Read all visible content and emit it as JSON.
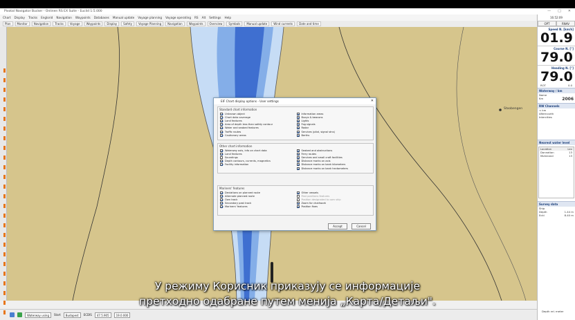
{
  "window": {
    "title": "Pivotal Navigator Bucker - Onlinen RS EX Suite - Euclid 1:5.000",
    "controls": [
      "—",
      "□",
      "✕"
    ]
  },
  "menu": [
    "Chart",
    "Display",
    "Tracks",
    "Englorid",
    "Navigation",
    "Waypoints",
    "Databases",
    "Manual update",
    "Voyage planning",
    "Voyage operating",
    "RS",
    "Alt",
    "Settings",
    "Help"
  ],
  "toolbar1": [
    "Plan",
    "Monitor",
    "Navigation",
    "Tracks",
    "Voyage",
    "Waypoints",
    "Display",
    "Safety",
    "Voyage Planning",
    "Navigation",
    "Waypoints",
    "Overview",
    "Symbols",
    "Manual update",
    "Wind currents",
    "Date and time"
  ],
  "toolbar2": {
    "look_ahead": "Look ahead",
    "center_ship": "Center ship",
    "scale": "Scale",
    "range": "Range"
  },
  "right_panel": {
    "time": "16:52:09",
    "tabs": [
      "OPT",
      "RNAV"
    ],
    "speed_label": "Speed N. [km/h]",
    "speed_value": "01.9",
    "course_label": "Course N. [°]",
    "course_value": "79.0",
    "heading_label": "Heading N. [°]",
    "heading_value": "79.0",
    "heading_extra_left": "ROT",
    "heading_extra_right": "0.0",
    "waterway_head": "Waterway / km",
    "waterway_rows": [
      [
        "Name",
        ""
      ],
      [
        "Km",
        "2006"
      ]
    ],
    "rw_head": "RW Channels",
    "rw_rows": [
      "< km",
      "Afterncorth",
      "Intercities"
    ],
    "nearest_head": "Nearest water level",
    "nearest_cols": [
      "Location",
      "Lev"
    ],
    "nearest_rows": [
      [
        "Donnation",
        "13"
      ],
      [
        "Mohnland",
        "13"
      ]
    ],
    "survey_head": "Survey data",
    "survey_rows": [
      [
        "Ship",
        ""
      ],
      [
        "Depth",
        "1.44 m"
      ],
      [
        "Ecki",
        "8.40 m"
      ]
    ],
    "bottom_label": "Depth rel. meter"
  },
  "map": {
    "place_label": "Stoobengen",
    "coast_color": "#d6c58c",
    "water_deep": "#3f6fd0",
    "water_mid": "#84aee8",
    "water_shallow": "#c6dcf5"
  },
  "dialog": {
    "title": "EIF Chart display options - User settings",
    "group1_title": "Standard chart information",
    "group1_left": [
      {
        "label": "Unknown object",
        "on": true
      },
      {
        "label": "Chart data coverage",
        "on": true
      },
      {
        "label": "Land features",
        "on": true
      },
      {
        "label": "Area of depth less than safety contour",
        "on": true
      },
      {
        "label": "Water and seabed features",
        "on": true
      },
      {
        "label": "Traffic routes",
        "on": true
      },
      {
        "label": "Cautionary areas",
        "on": true
      }
    ],
    "group1_right": [
      {
        "label": "Information areas",
        "on": true
      },
      {
        "label": "Buoys & beacons",
        "on": true
      },
      {
        "label": "Lights",
        "on": true
      },
      {
        "label": "Fog signals",
        "on": true
      },
      {
        "label": "Radar",
        "on": true
      },
      {
        "label": "Services (pilot, signal stns)",
        "on": true
      },
      {
        "label": "Berths",
        "on": true
      }
    ],
    "group2_title": "Other chart information",
    "group2_left": [
      {
        "label": "Waterway axis, info on chart data",
        "on": true
      },
      {
        "label": "Land features",
        "on": true
      },
      {
        "label": "Soundings",
        "on": false
      },
      {
        "label": "Depth contours, currents, magnetics",
        "on": true
      },
      {
        "label": "Facility information",
        "on": true
      }
    ],
    "group2_right": [
      {
        "label": "Seabed and obstructions",
        "on": true
      },
      {
        "label": "Ferry routes",
        "on": true
      },
      {
        "label": "Services and small craft facilities",
        "on": true
      },
      {
        "label": "Distance marks on axis",
        "on": true
      },
      {
        "label": "Distance marks on bank kilometers",
        "on": true
      },
      {
        "label": "Distance marks on bank hectometers",
        "on": true
      }
    ],
    "group3_title": "Mariners' features",
    "group3_left": [
      {
        "label": "Deviations on planned route",
        "on": true
      },
      {
        "label": "Alternate planned route",
        "on": true
      },
      {
        "label": "Own track",
        "on": true
      },
      {
        "label": "Secondary past track",
        "on": true
      },
      {
        "label": "Mariners' features",
        "on": true
      }
    ],
    "group3_right": [
      {
        "label": "Other vessels",
        "on": true,
        "dis": false
      },
      {
        "label": "Past positions features",
        "on": false,
        "dis": true
      },
      {
        "label": "Position designated to own ship",
        "on": false,
        "dis": true
      },
      {
        "label": "Zoom for chartwork",
        "on": true,
        "dis": false
      },
      {
        "label": "Position fixes",
        "on": true,
        "dis": false
      }
    ],
    "accept": "Accept",
    "cancel": "Cancel"
  },
  "statusbar": {
    "mode": "Waterway using",
    "start": "Start",
    "start_value": "Budapest",
    "extra": "ECDIS",
    "coord1": "47.5.905",
    "coord2": "19.0.000"
  },
  "subtitles": {
    "line1": "У режиму Корисник приказују се информације",
    "line2": "претходно одабране путем менија „Карта/Детаљи\"."
  }
}
